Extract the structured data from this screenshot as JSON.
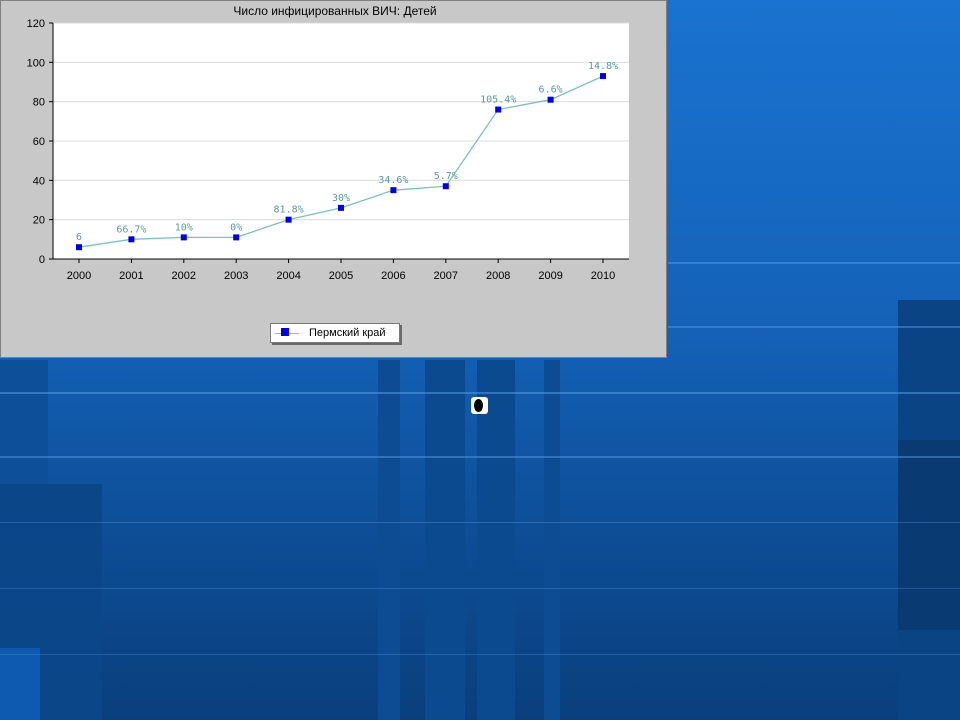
{
  "chart_data": {
    "type": "line",
    "title": "Число инфицированных ВИЧ: Детей",
    "xlabel": "",
    "ylabel": "",
    "categories": [
      "2000",
      "2001",
      "2002",
      "2003",
      "2004",
      "2005",
      "2006",
      "2007",
      "2008",
      "2009",
      "2010"
    ],
    "ylim": [
      0,
      120
    ],
    "yticks": [
      0,
      20,
      40,
      60,
      80,
      100,
      120
    ],
    "grid": true,
    "legend_position": "bottom-center",
    "series": [
      {
        "name": "Пермский край",
        "values": [
          6,
          10,
          11,
          11,
          20,
          26,
          35,
          37,
          76,
          81,
          93
        ],
        "labels": [
          "6",
          "66.7%",
          "10%",
          "0%",
          "81.8%",
          "30%",
          "34.6%",
          "5.7%",
          "105.4%",
          "6.6%",
          "14.8%"
        ],
        "line_color": "#7fbfc0",
        "marker_color": "#0000dd",
        "label_color": "#5a9a9a"
      }
    ]
  }
}
